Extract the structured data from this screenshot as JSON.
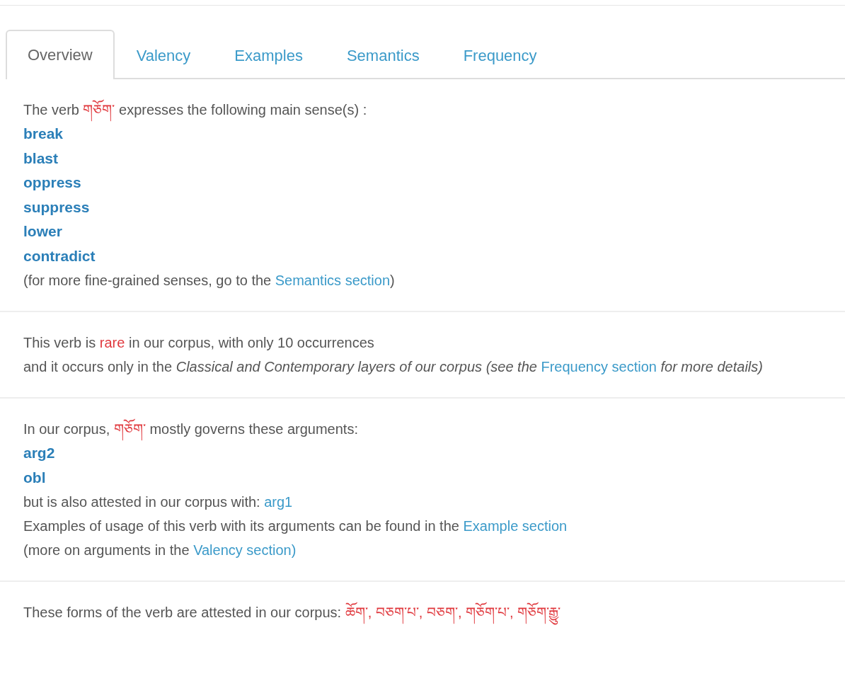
{
  "tabs": [
    {
      "label": "Overview",
      "selected": true
    },
    {
      "label": "Valency",
      "selected": false
    },
    {
      "label": "Examples",
      "selected": false
    },
    {
      "label": "Semantics",
      "selected": false
    },
    {
      "label": "Frequency",
      "selected": false
    }
  ],
  "sections": [
    {
      "lines": [
        {
          "kind": "sentence",
          "parts": [
            {
              "kind": "text",
              "text": "The verb "
            },
            {
              "kind": "term",
              "text": "གཅོག་"
            },
            {
              "kind": "text",
              "text": " expresses the following main sense(s) :"
            }
          ]
        },
        {
          "kind": "heading",
          "text": "break"
        },
        {
          "kind": "heading",
          "text": "blast"
        },
        {
          "kind": "heading",
          "text": "oppress"
        },
        {
          "kind": "heading",
          "text": "suppress"
        },
        {
          "kind": "heading",
          "text": "lower"
        },
        {
          "kind": "heading",
          "text": "contradict"
        },
        {
          "kind": "sentence",
          "parts": [
            {
              "kind": "text",
              "text": "(for more fine-grained senses, go to the "
            },
            {
              "kind": "link",
              "text": "Semantics section"
            },
            {
              "kind": "text",
              "text": ")"
            }
          ]
        }
      ]
    },
    {
      "lines": [
        {
          "kind": "sentence",
          "parts": [
            {
              "kind": "text",
              "text": "This verb is "
            },
            {
              "kind": "term",
              "text": "rare"
            },
            {
              "kind": "text",
              "text": " in our corpus, with only 10 occurrences"
            }
          ]
        },
        {
          "kind": "sentence",
          "parts": [
            {
              "kind": "text",
              "text": "and it occurs only in the "
            },
            {
              "kind": "italic",
              "text": "Classical and Contemporary layers of our corpus (see the "
            },
            {
              "kind": "link",
              "text": "Frequency section"
            },
            {
              "kind": "italic",
              "text": " for more details)"
            }
          ]
        }
      ]
    },
    {
      "lines": [
        {
          "kind": "sentence",
          "parts": [
            {
              "kind": "text",
              "text": "In our corpus, "
            },
            {
              "kind": "term",
              "text": "གཅོག་"
            },
            {
              "kind": "text",
              "text": " mostly governs these arguments:"
            }
          ]
        },
        {
          "kind": "heading",
          "text": "arg2"
        },
        {
          "kind": "heading",
          "text": "obl"
        },
        {
          "kind": "sentence",
          "parts": [
            {
              "kind": "text",
              "text": "but is also attested in our corpus with: "
            },
            {
              "kind": "link",
              "text": "arg1"
            }
          ]
        },
        {
          "kind": "sentence",
          "parts": [
            {
              "kind": "text",
              "text": "Examples of usage of this verb with its arguments can be found in the "
            },
            {
              "kind": "link",
              "text": "Example section"
            }
          ]
        },
        {
          "kind": "sentence",
          "parts": [
            {
              "kind": "text",
              "text": "(more on arguments in the "
            },
            {
              "kind": "link",
              "text": "Valency section)"
            }
          ]
        }
      ]
    },
    {
      "lines": [
        {
          "kind": "sentence",
          "parts": [
            {
              "kind": "text",
              "text": "These forms of the verb are attested in our corpus: "
            },
            {
              "kind": "term",
              "text": "ཆོག་, བཅག་པ་, བཅག་, གཅོག་པ་, གཅོག་རྒྱུ་"
            }
          ]
        }
      ]
    }
  ]
}
